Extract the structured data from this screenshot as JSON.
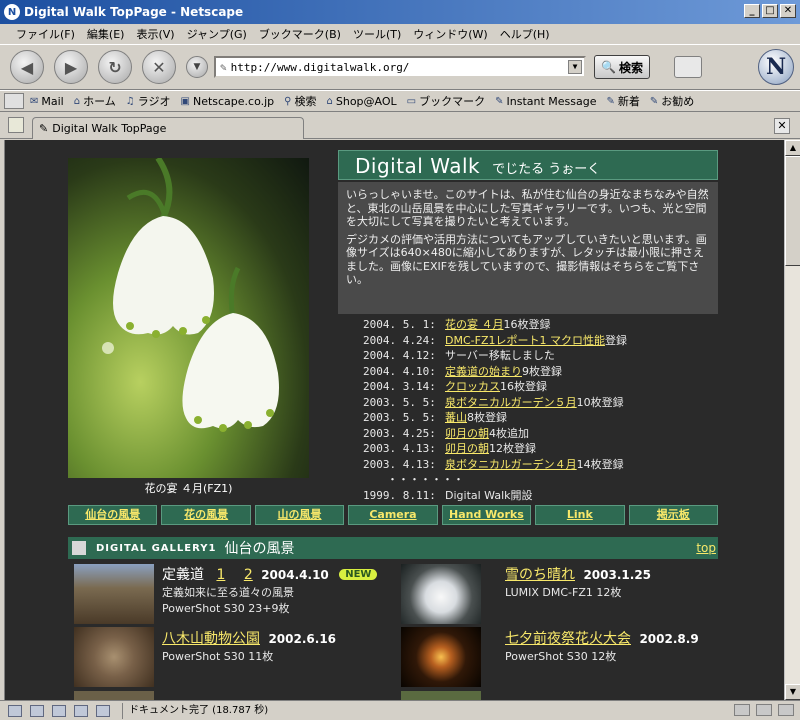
{
  "window": {
    "title": "Digital Walk TopPage - Netscape"
  },
  "menu": [
    "ファイル(F)",
    "編集(E)",
    "表示(V)",
    "ジャンプ(G)",
    "ブックマーク(B)",
    "ツール(T)",
    "ウィンドウ(W)",
    "ヘルプ(H)"
  ],
  "nav": {
    "url": "http://www.digitalwalk.org/",
    "search_label": "検索"
  },
  "personal_toolbar": [
    "Mail",
    "ホーム",
    "ラジオ",
    "Netscape.co.jp",
    "検索",
    "Shop@AOL",
    "ブックマーク",
    "Instant Message",
    "新着",
    "お勧め"
  ],
  "tab": {
    "label": "Digital Walk TopPage"
  },
  "page": {
    "caption": "花の宴 ４月(FZ1)",
    "title": "Digital Walk",
    "subtitle": "でじたる うぉーく",
    "intro1": "いらっしゃいませ。このサイトは、私が住む仙台の身近なまちなみや自然と、東北の山岳風景を中心にした写真ギャラリーです。いつも、光と空間を大切にして写真を撮りたいと考えています。",
    "intro2": "デジカメの評価や活用方法についてもアップしていきたいと思います。画像サイズは640×480に縮小してありますが、レタッチは最小限に押さえました。画像にEXIFを残していますので、撮影情報はそちらをご覧下さい。",
    "news": [
      {
        "date": "2004. 5. 1:",
        "link": "花の宴 ４月",
        "text": "16枚登録"
      },
      {
        "date": "2004. 4.24:",
        "link": "DMC-FZ1レポート1 マクロ性能",
        "text": " 登録"
      },
      {
        "date": "2004. 4.12:",
        "link": "",
        "text": "サーバー移転しました"
      },
      {
        "date": "2004. 4.10:",
        "link": "定義道の始まり",
        "text": "9枚登録"
      },
      {
        "date": "2004. 3.14:",
        "link": "クロッカス",
        "text": "16枚登録"
      },
      {
        "date": "2003. 5. 5:",
        "link": "泉ボタニカルガーデン５月",
        "text": "10枚登録"
      },
      {
        "date": "2003. 5. 5:",
        "link": "蕃山",
        "text": "8枚登録"
      },
      {
        "date": "2003. 4.25:",
        "link": "卯月の朝",
        "text": "4枚追加"
      },
      {
        "date": "2003. 4.13:",
        "link": "卯月の朝",
        "text": "12枚登録"
      },
      {
        "date": "2003. 4.13:",
        "link": "泉ボタニカルガーデン４月",
        "text": "14枚登録"
      }
    ],
    "news_dots": "・・・・・・・",
    "opened": {
      "date": "1999. 8.11:",
      "text": "Digital Walk開設"
    },
    "categories": [
      "仙台の風景",
      "花の風景",
      "山の風景",
      "Camera",
      "Hand Works",
      "Link",
      "掲示板"
    ],
    "gallery": {
      "label": "DIGITAL GALLERY1",
      "name": "仙台の風景",
      "top": "top"
    },
    "items": [
      {
        "title": "定義道",
        "links": [
          "1",
          "2"
        ],
        "date": "2004.4.10",
        "badge": "NEW",
        "desc": "定義如来に至る道々の風景",
        "cam": "PowerShot S30  23+9枚"
      },
      {
        "title": "雪のち晴れ",
        "date": "2003.1.25",
        "cam": "LUMIX DMC-FZ1 12枚"
      },
      {
        "title": "八木山動物公園",
        "date": "2002.6.16",
        "cam": "PowerShot S30  11枚"
      },
      {
        "title": "七夕前夜祭花火大会",
        "date": "2002.8.9",
        "cam": "PowerShot S30  12枚"
      }
    ]
  },
  "status": {
    "text": "ドキュメント完了 (18.787 秒)"
  }
}
